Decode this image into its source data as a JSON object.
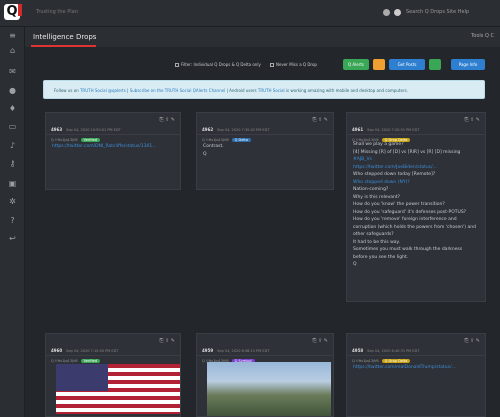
{
  "topbar": {
    "logo": "Q",
    "tagline": "Trusting the Plan",
    "search": "Search Q Drops   Site Help"
  },
  "header": {
    "title": "Intelligence Drops",
    "right": "Tools   Q   C"
  },
  "controls": {
    "filter_label": "Filter: Individual Q Drops & Q Delta only",
    "show_label": "Never Miss a Q Drop",
    "btn1": "Q Alerts",
    "btn2": "",
    "btn3": "Get Posts",
    "btn4": "",
    "btn5": "Page Info"
  },
  "notice": {
    "text1": "Follow us on ",
    "link1": "TRUTH Social @qalerts",
    "text2": " | ",
    "link2": "Subscribe on the TRUTH Social QAlerts Channel",
    "text3": " | Android users ",
    "link3": "TRUTH Social",
    "text4": " is working amazing with mobile and desktop and computers."
  },
  "cards": [
    {
      "id": "4963",
      "meta": "Sep 04, 2020 10:50:01 PM EDT",
      "meta2": "Q !!Hs1Jq13jV6",
      "badge": "Verified",
      "badge_color": "#3aa757",
      "body_link": "https://twitter.com/DNI_Ratcliffe/status/1301...",
      "body": []
    },
    {
      "id": "4962",
      "meta": "Sep 04, 2020 7:30:02 PM EDT",
      "meta2": "Q !!Hs1Jq13jV6",
      "badge": "Q Delta",
      "badge_color": "#2e6fb0",
      "body_link": "",
      "body": [
        "Contrast.",
        "Q"
      ]
    },
    {
      "id": "4961",
      "meta": "Sep 04, 2020 7:20:51 PM EDT",
      "meta2": "Q !!Hs1Jq13jV6",
      "badge": "Q Drop Delta",
      "badge_color": "#c8a215",
      "body_link": "",
      "body": [
        "Shall we play a game?",
        "[4] Missing [R] of [D] vs [RIR] vs [R] [D] missing",
        "#AJB_Vs",
        "https://twitter.com/JoeBiden/status/...",
        "Who stepped down today [Remote]?",
        "Who stepped down (NY)?",
        "Nation-coming?",
        "Why is this relevant?",
        "How do you 'know' the power transition?",
        "How do you 'safeguard' it's defenses post-POTUS?",
        "How do you 'remove' foreign interference and",
        "corruption (which holds the powers from 'chosen') and",
        "other safeguards?",
        "It had to be this way.",
        "Sometimes you must walk through the darkness",
        "before you see the light.",
        "Q"
      ]
    },
    {
      "id": "4960",
      "meta": "Sep 04, 2020 7:15:00 PM EDT",
      "meta2": "Q !!Hs1Jq13jV6",
      "badge": "Verified",
      "badge_color": "#3aa757",
      "body_link": "",
      "body": []
    },
    {
      "id": "4959",
      "meta": "Sep 04, 2020 6:58:12 PM EDT",
      "meta2": "Q !!Hs1Jq13jV6",
      "badge": "Q Symbol",
      "badge_color": "#7b3fd1",
      "body_link": "",
      "body": []
    },
    {
      "id": "4958",
      "meta": "Sep 04, 2020 6:40:31 PM EDT",
      "meta2": "Q !!Hs1Jq13jV6",
      "badge": "Q Drop Delta",
      "badge_color": "#c8a215",
      "body_link": "https://twitter.com/realDonaldTrump/status/...",
      "body": []
    }
  ],
  "icons": [
    "home-icon",
    "chat-icon",
    "apple-icon",
    "android-icon",
    "desktop-icon",
    "bell-icon",
    "key-icon",
    "briefcase-icon",
    "gear-icon",
    "help-icon",
    "logout-icon"
  ]
}
